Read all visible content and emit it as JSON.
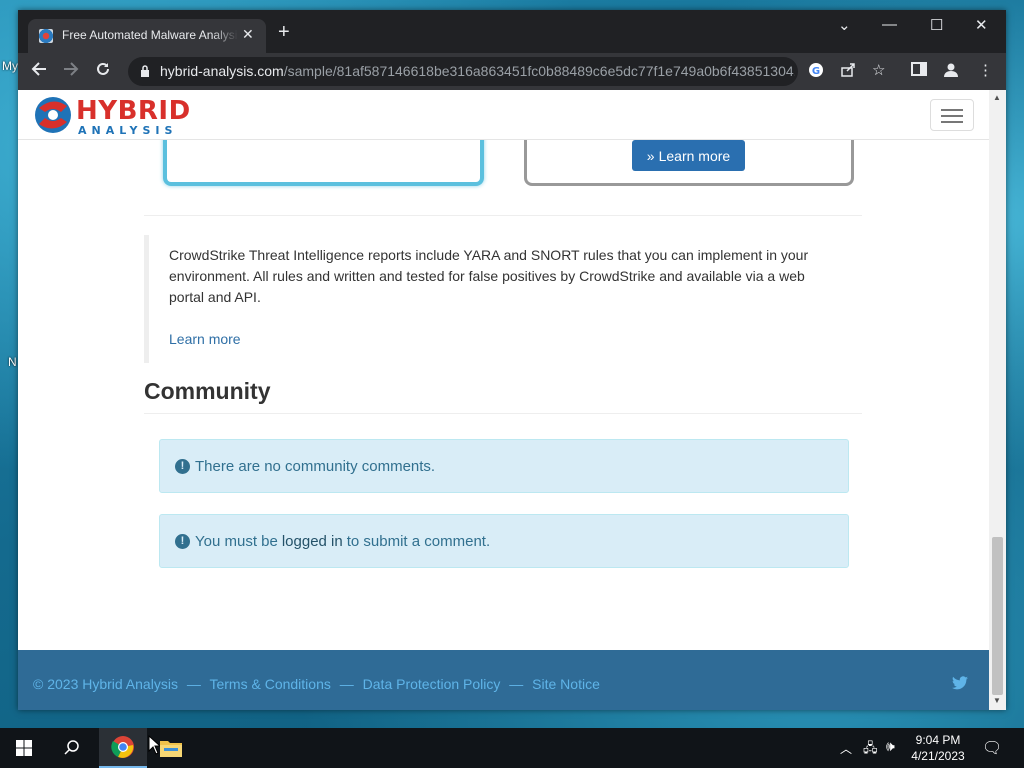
{
  "desktop": {
    "labels": [
      "My",
      "N"
    ]
  },
  "browser": {
    "tab_title": "Free Automated Malware Analysis",
    "tab_close": "✕",
    "new_tab": "+",
    "url_host": "hybrid-analysis.com",
    "url_path": "/sample/81af587146618be316a863451fc0b88489c6e5dc77f1e749a0b6f43851304..."
  },
  "site": {
    "logo_main": "HYBRID",
    "logo_sub": "ANALYSIS",
    "learn_more_button": "Learn more",
    "blockquote_text": "CrowdStrike Threat Intelligence reports include YARA and SNORT rules that you can implement in your environment. All rules and written and tested for false positives by CrowdStrike and available via a web portal and API.",
    "blockquote_link": "Learn more",
    "community_title": "Community",
    "alert_no_comments": "There are no community comments.",
    "alert_login_pre": "You must be",
    "alert_login_link": "logged in",
    "alert_login_post": "to submit a comment.",
    "footer": {
      "copyright": "© 2023 Hybrid Analysis",
      "sep": "—",
      "terms": "Terms & Conditions",
      "privacy": "Data Protection Policy",
      "notice": "Site Notice"
    }
  },
  "taskbar": {
    "time": "9:04 PM",
    "date": "4/21/2023"
  },
  "colors": {
    "brand_red": "#d8302b",
    "brand_blue": "#1f73b7",
    "alert_bg": "#d9edf7",
    "footer_bg": "#2f6b96",
    "button_blue": "#2a6fb0"
  }
}
